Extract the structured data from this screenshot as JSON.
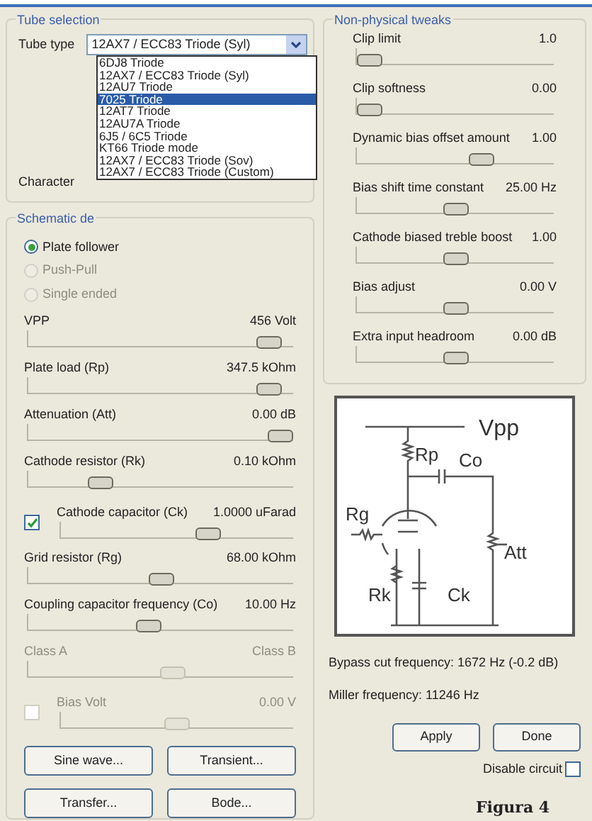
{
  "tube_selection": {
    "title": "Tube selection",
    "tube_type_label": "Tube type",
    "tube_type_value": "12AX7 / ECC83 Triode (Syl)",
    "options": [
      {
        "label": "6DJ8 Triode",
        "selected": false
      },
      {
        "label": "12AX7 / ECC83 Triode (Syl)",
        "selected": false
      },
      {
        "label": "12AU7 Triode",
        "selected": false
      },
      {
        "label": "7025 Triode",
        "selected": true
      },
      {
        "label": "12AT7 Triode",
        "selected": false
      },
      {
        "label": "12AU7A Triode",
        "selected": false
      },
      {
        "label": "6J5 / 6C5 Triode",
        "selected": false
      },
      {
        "label": "KT66 Triode mode",
        "selected": false
      },
      {
        "label": "12AX7 / ECC83 Triode (Sov)",
        "selected": false
      },
      {
        "label": "12AX7 / ECC83 Triode (Custom)",
        "selected": false
      }
    ],
    "character_label": "Character"
  },
  "schematic": {
    "title": "Schematic de",
    "modes": [
      {
        "label": "Plate follower",
        "selected": true,
        "disabled": false
      },
      {
        "label": "Push-Pull",
        "selected": false,
        "disabled": true
      },
      {
        "label": "Single ended",
        "selected": false,
        "disabled": true
      }
    ],
    "sliders": [
      {
        "kind": "slider",
        "label": "VPP",
        "value": "456 Volt",
        "level": 0.95,
        "disabled": false
      },
      {
        "kind": "slider",
        "label": "Plate load (Rp)",
        "value": "347.5 kOhm",
        "level": 0.95,
        "disabled": false
      },
      {
        "kind": "slider",
        "label": "Attenuation (Att)",
        "value": "0.00 dB",
        "level": 1,
        "disabled": false
      },
      {
        "kind": "slider",
        "label": "Cathode resistor (Rk)",
        "value": "0.10 kOhm",
        "level": 0.25,
        "disabled": false
      },
      {
        "kind": "check",
        "label": "Cathode capacitor (Ck)",
        "value": "1.0000 uFarad",
        "level": 0.65,
        "disabled": false,
        "checked": true
      },
      {
        "kind": "slider",
        "label": "Grid resistor (Rg)",
        "value": "68.00 kOhm",
        "level": 0.5,
        "disabled": false
      },
      {
        "kind": "slider",
        "label": "Coupling capacitor frequency (Co)",
        "value": "10.00 Hz",
        "level": 0.45,
        "disabled": false
      },
      {
        "kind": "slider",
        "label": "Class A",
        "value": "Class B",
        "level": 0.55,
        "disabled": true
      },
      {
        "kind": "check",
        "label": "Bias Volt",
        "value": "0.00 V",
        "level": 0.5,
        "disabled": true,
        "checked": false
      }
    ],
    "buttons": [
      "Sine wave...",
      "Transient...",
      "Transfer...",
      "Bode..."
    ]
  },
  "tweaks": {
    "title": "Non-physical tweaks",
    "sliders": [
      {
        "label": "Clip limit",
        "value": "1.0",
        "level": 0
      },
      {
        "label": "Clip softness",
        "value": "0.00",
        "level": 0
      },
      {
        "label": "Dynamic bias offset amount",
        "value": "1.00",
        "level": 0.65
      },
      {
        "label": "Bias shift time constant",
        "value": "25.00 Hz",
        "level": 0.5
      },
      {
        "label": "Cathode biased treble boost",
        "value": "1.00",
        "level": 0.5
      },
      {
        "label": "Bias adjust",
        "value": "0.00 V",
        "level": 0.5
      },
      {
        "label": "Extra input headroom",
        "value": "0.00 dB",
        "level": 0.5
      }
    ]
  },
  "circuit_labels": [
    "Vpp",
    "Rp",
    "Co",
    "Rg",
    "Att",
    "Rk",
    "Ck"
  ],
  "bypass_text": "Bypass cut frequency: 1672 Hz (-0.2 dB)",
  "miller_text": "Miller frequency: 11246 Hz",
  "actions": [
    "Apply",
    "Done"
  ],
  "disable_circuit": {
    "label": "Disable circuit",
    "checked": false
  },
  "caption": "Figura 4"
}
